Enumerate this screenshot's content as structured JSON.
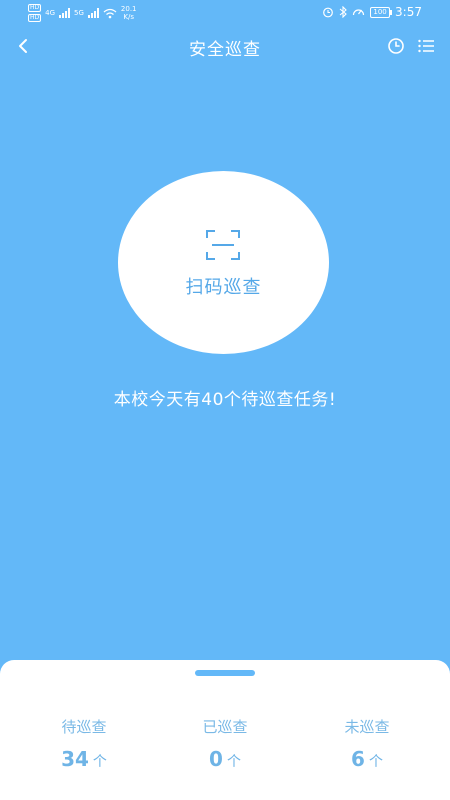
{
  "status_bar": {
    "hd1": "HD",
    "hd2": "HD",
    "net1": "4G",
    "net2": "5G",
    "speed_value": "20.1",
    "speed_unit": "K/s",
    "battery": "100",
    "time": "3:57"
  },
  "header": {
    "title": "安全巡查"
  },
  "scan": {
    "label": "扫码巡查"
  },
  "message": "本校今天有40个待巡查任务!",
  "stats": [
    {
      "label": "待巡查",
      "value": "34",
      "unit": "个"
    },
    {
      "label": "已巡查",
      "value": "0",
      "unit": "个"
    },
    {
      "label": "未巡查",
      "value": "6",
      "unit": "个"
    }
  ],
  "colors": {
    "background": "#63b8f8",
    "accent": "#55a8e8",
    "panel": "#ffffff"
  }
}
